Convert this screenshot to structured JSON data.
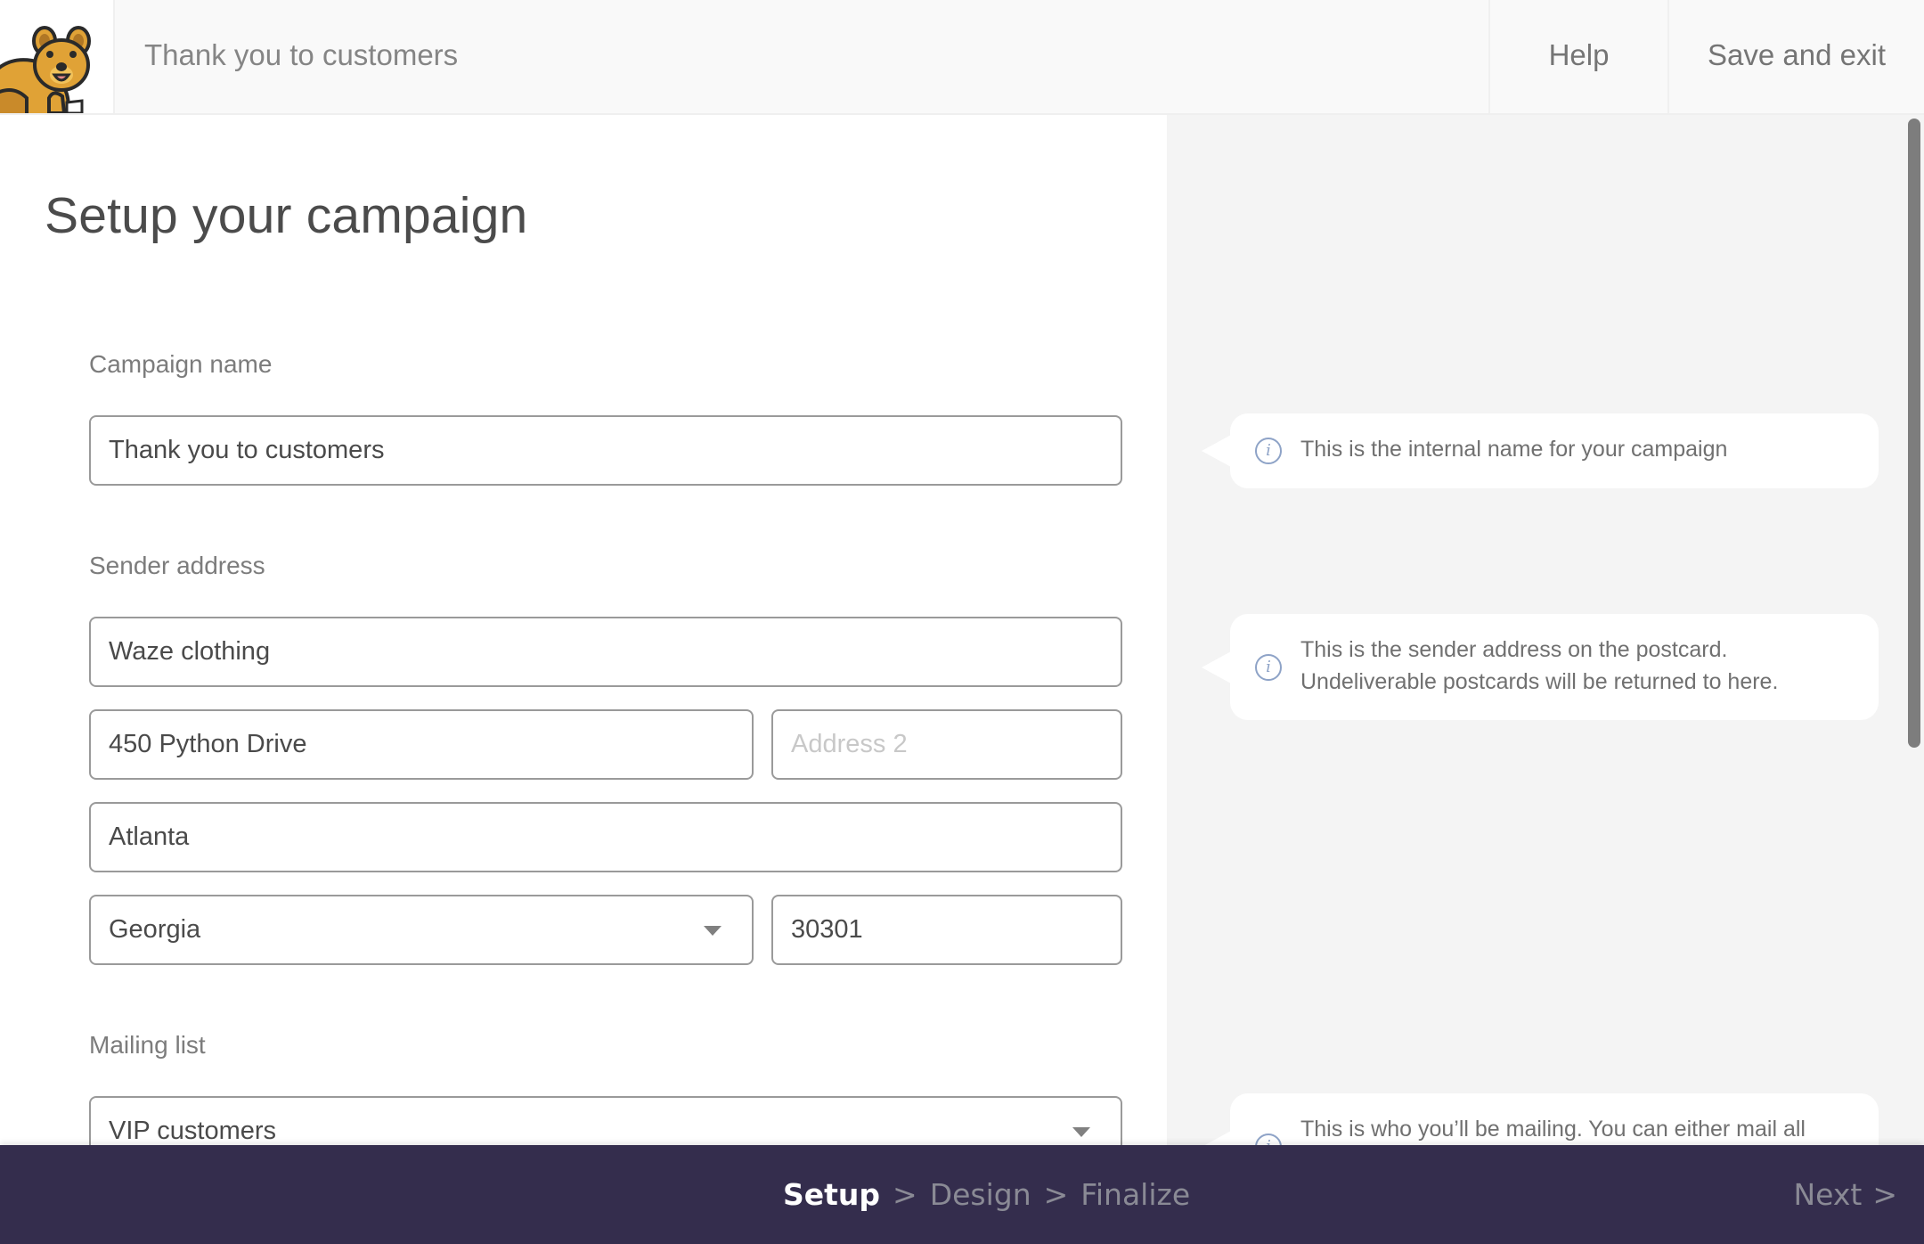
{
  "header": {
    "logo_alt": "quokka-mascot",
    "title": "Thank you to customers",
    "help_label": "Help",
    "save_exit_label": "Save and exit"
  },
  "form": {
    "page_title": "Setup your campaign",
    "campaign_name": {
      "label": "Campaign name",
      "value": "Thank you to customers"
    },
    "sender_address": {
      "label": "Sender address",
      "name_value": "Waze clothing",
      "address1_value": "450 Python Drive",
      "address2_value": "",
      "address2_placeholder": "Address 2",
      "city_value": "Atlanta",
      "state_value": "Georgia",
      "zip_value": "30301"
    },
    "mailing_list": {
      "label": "Mailing list",
      "value": "VIP customers"
    }
  },
  "tips": {
    "campaign_name": "This is the internal name for your campaign",
    "sender_address": "This is the sender address on the postcard. Undeliverable postcards will be returned to here.",
    "mailing_list": "This is who you’ll be mailing. You can either mail all"
  },
  "footer": {
    "steps": [
      {
        "label": "Setup",
        "active": true
      },
      {
        "label": "Design",
        "active": false
      },
      {
        "label": "Finalize",
        "active": false
      }
    ],
    "separator": ">",
    "next_label": "Next",
    "next_chevron": ">"
  },
  "colors": {
    "footer_bg": "#342d4d",
    "header_bg": "#f9f9f9",
    "help_panel_bg": "#f4f4f4",
    "info_icon": "#8ea3c7"
  }
}
